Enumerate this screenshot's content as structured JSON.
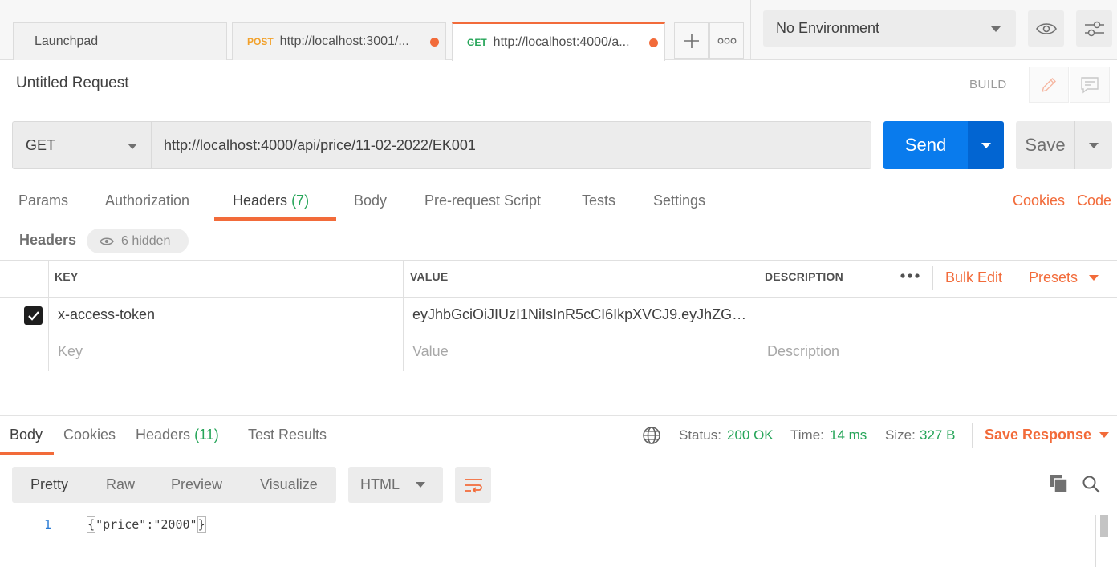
{
  "tabs": [
    {
      "label": "Launchpad",
      "method": "",
      "method_color": ""
    },
    {
      "label": "http://localhost:3001/...",
      "method": "POST",
      "method_color": "#f2a12b"
    },
    {
      "label": "http://localhost:4000/a...",
      "method": "GET",
      "method_color": "#26a559"
    }
  ],
  "tab_icons": {
    "add": "plus-icon",
    "more": "ellipsis-icon"
  },
  "environment": {
    "selected": "No Environment"
  },
  "request": {
    "title": "Untitled Request",
    "build_label": "BUILD",
    "method": "GET",
    "url": "http://localhost:4000/api/price/11-02-2022/EK001",
    "send_label": "Send",
    "save_label": "Save"
  },
  "request_tabs": {
    "params": "Params",
    "authorization": "Authorization",
    "headers": "Headers",
    "headers_count": "(7)",
    "body": "Body",
    "prerequest": "Pre-request Script",
    "tests": "Tests",
    "settings": "Settings",
    "cookies": "Cookies",
    "code": "Code"
  },
  "headers_section": {
    "label": "Headers",
    "hidden_label": "6 hidden",
    "columns": {
      "key": "KEY",
      "value": "VALUE",
      "description": "DESCRIPTION"
    },
    "bulk_edit": "Bulk Edit",
    "presets": "Presets",
    "rows": [
      {
        "checked": true,
        "key": "x-access-token",
        "value": "eyJhbGciOiJIUzI1NiIsInR5cCI6IkpXVCJ9.eyJhZG1pb...",
        "description": ""
      }
    ],
    "placeholders": {
      "key": "Key",
      "value": "Value",
      "description": "Description"
    }
  },
  "response": {
    "tabs": {
      "body": "Body",
      "cookies": "Cookies",
      "headers": "Headers",
      "headers_count": "(11)",
      "test_results": "Test Results"
    },
    "status_label": "Status:",
    "status_value": "200 OK",
    "time_label": "Time:",
    "time_value": "14 ms",
    "size_label": "Size:",
    "size_value": "327 B",
    "save_response": "Save Response",
    "views": {
      "pretty": "Pretty",
      "raw": "Raw",
      "preview": "Preview",
      "visualize": "Visualize"
    },
    "language": "HTML",
    "line_number": "1",
    "body_open": "{",
    "body_text": "\"price\":\"2000\"",
    "body_close": "}"
  },
  "colors": {
    "accent": "#f26b3a",
    "send": "#097bed",
    "success": "#26a559"
  }
}
